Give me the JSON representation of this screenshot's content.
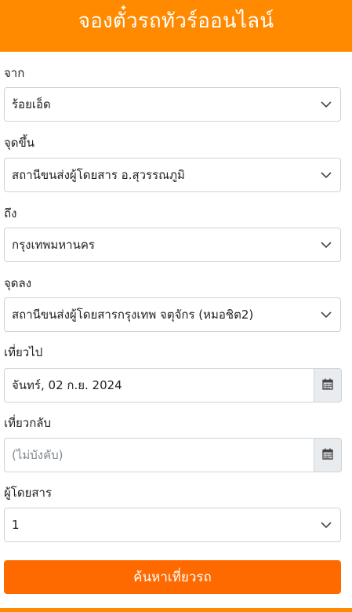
{
  "header": {
    "title": "จองตั๋วรถทัวร์ออนไลน์"
  },
  "form": {
    "from": {
      "label": "จาก",
      "value": "ร้อยเอ็ด"
    },
    "pickup": {
      "label": "จุดขึ้น",
      "value": "สถานีขนส่งผู้โดยสาร อ.สุวรรณภูมิ"
    },
    "to": {
      "label": "ถึง",
      "value": "กรุงเทพมหานคร"
    },
    "dropoff": {
      "label": "จุดลง",
      "value": "สถานีขนส่งผู้โดยสารกรุงเทพ จตุจักร (หมอชิต2)"
    },
    "depart": {
      "label": "เที่ยวไป",
      "value": "จันทร์, 02 ก.ย. 2024"
    },
    "return": {
      "label": "เที่ยวกลับ",
      "placeholder": "(ไม่บังคับ)"
    },
    "passengers": {
      "label": "ผู้โดยสาร",
      "value": "1"
    },
    "search_label": "ค้นหาเที่ยวรถ"
  },
  "icons": {
    "dropdown": "chevron-down-icon",
    "calendar": "calendar-icon"
  },
  "colors": {
    "header": "#ff8a00",
    "button": "#ff6a00"
  }
}
